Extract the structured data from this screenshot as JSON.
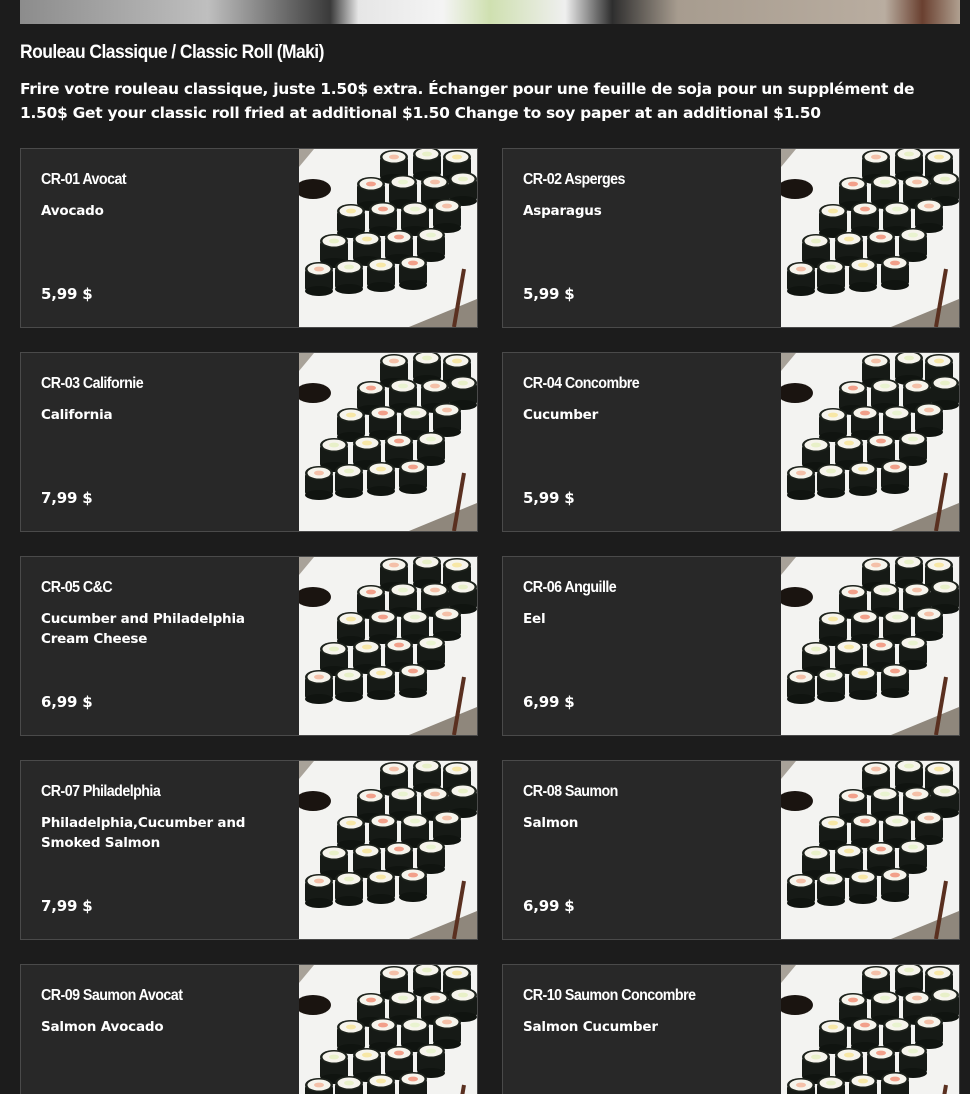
{
  "section": {
    "title": "Rouleau Classique / Classic Roll (Maki)",
    "description": "Frire votre rouleau classique, juste 1.50$ extra. Échanger pour une feuille de soja pour un supplément de 1.50$ Get your classic roll fried at additional $1.50 Change to soy paper at an additional $1.50"
  },
  "items": [
    {
      "name": "CR-01 Avocat",
      "description": "Avocado",
      "price": "5,99 $"
    },
    {
      "name": "CR-02 Asperges",
      "description": "Asparagus",
      "price": "5,99 $"
    },
    {
      "name": "CR-03 Californie",
      "description": "California",
      "price": "7,99 $"
    },
    {
      "name": "CR-04 Concombre",
      "description": "Cucumber",
      "price": "5,99 $"
    },
    {
      "name": "CR-05 C&C",
      "description": "Cucumber and Philadelphia Cream Cheese",
      "price": "6,99 $"
    },
    {
      "name": "CR-06 Anguille",
      "description": "Eel",
      "price": "6,99 $"
    },
    {
      "name": "CR-07 Philadelphia",
      "description": "Philadelphia,Cucumber and Smoked Salmon",
      "price": "7,99 $"
    },
    {
      "name": "CR-08 Saumon",
      "description": "Salmon",
      "price": "6,99 $"
    },
    {
      "name": "CR-09 Saumon Avocat",
      "description": "Salmon Avocado",
      "price": ""
    },
    {
      "name": "CR-10 Saumon Concombre",
      "description": "Salmon Cucumber",
      "price": ""
    }
  ]
}
